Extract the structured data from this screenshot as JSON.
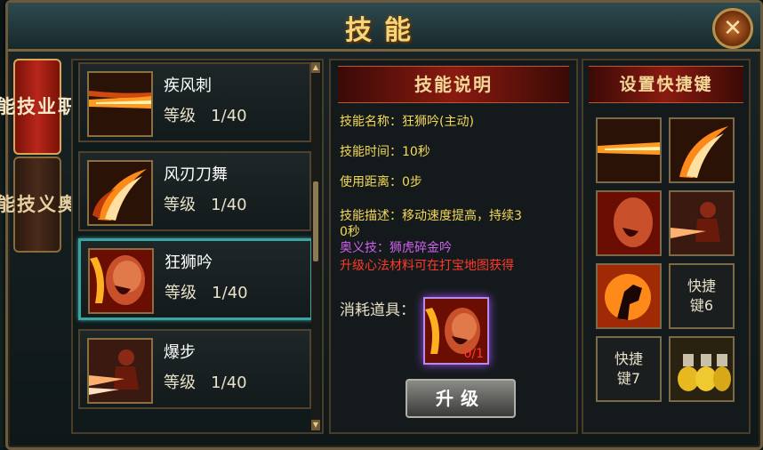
{
  "window": {
    "title": "技能",
    "close_label": "✕"
  },
  "tabs": [
    {
      "label": "职业技能",
      "chars": [
        "职",
        "业",
        "技",
        "能"
      ],
      "active": true
    },
    {
      "label": "奥义技能",
      "chars": [
        "奥",
        "义",
        "技",
        "能"
      ],
      "active": false
    }
  ],
  "skills": [
    {
      "name": "疾风刺",
      "level_label": "等级",
      "level": "1/40",
      "icon": "blade-slash-icon"
    },
    {
      "name": "风刃刀舞",
      "level_label": "等级",
      "level": "1/40",
      "icon": "blade-dance-icon"
    },
    {
      "name": "狂狮吟",
      "level_label": "等级",
      "level": "1/40",
      "icon": "roar-icon",
      "selected": true
    },
    {
      "name": "爆步",
      "level_label": "等级",
      "level": "1/40",
      "icon": "burst-step-icon"
    }
  ],
  "description": {
    "header": "技能说明",
    "lines": [
      "技能名称：狂狮吟(主动)",
      "技能时间：10秒",
      "使用距离：0步",
      "技能描述：移动速度提高，持续3",
      "0秒"
    ],
    "secret_skill": "奥义技：狮虎碎金吟",
    "material_hint": "升级心法材料可在打宝地图获得",
    "consume_label": "消耗道具：",
    "item_count": "0/1",
    "upgrade_label": "升级"
  },
  "shortcuts": {
    "header": "设置快捷键",
    "slots": [
      {
        "icon": "blade-slash-icon",
        "label": ""
      },
      {
        "icon": "blade-dance-icon",
        "label": ""
      },
      {
        "icon": "roar-icon",
        "label": ""
      },
      {
        "icon": "burst-step-icon",
        "label": ""
      },
      {
        "icon": "fire-fist-icon",
        "label": ""
      },
      {
        "icon": "",
        "label": "快捷键6"
      },
      {
        "icon": "",
        "label": "快捷键7"
      },
      {
        "icon": "potion-icon",
        "label": ""
      }
    ]
  },
  "colors": {
    "title": "#f3d57a",
    "desc_text": "#f4d858",
    "secret": "#d060f0",
    "hint": "#ff3a2a",
    "selected_border": "#3aa5a0"
  }
}
